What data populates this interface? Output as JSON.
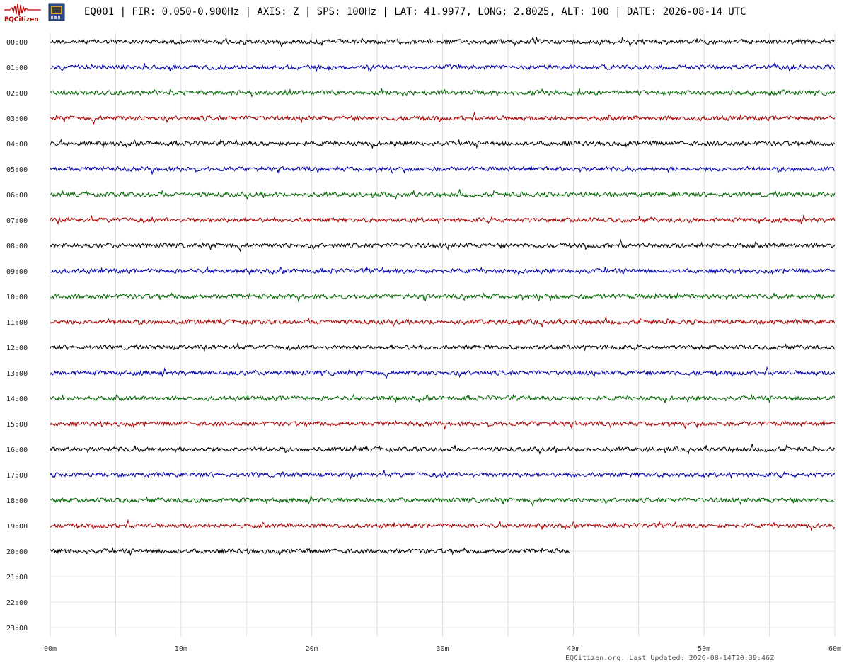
{
  "header": {
    "logo_text": "EQCitizen",
    "title": "EQ001 | FIR: 0.050-0.900Hz | AXIS: Z | SPS: 100Hz | LAT: 41.9977, LONG: 2.8025, ALT: 100 | DATE: 2026-08-14 UTC"
  },
  "footer": {
    "text": "EQCitizen.org. Last Updated: 2026-08-14T20:39:46Z"
  },
  "chart_data": {
    "type": "line",
    "title": "",
    "xlabel": "",
    "ylabel": "",
    "grid": true,
    "xlim": [
      0,
      60
    ],
    "x_tick_labels": [
      "00m",
      "10m",
      "20m",
      "30m",
      "40m",
      "50m",
      "60m"
    ],
    "x_ticks_minutes": [
      0,
      10,
      20,
      30,
      40,
      50,
      60
    ],
    "x_minor_step_minutes": 5,
    "row_labels": [
      "00:00",
      "01:00",
      "02:00",
      "03:00",
      "04:00",
      "05:00",
      "06:00",
      "07:00",
      "08:00",
      "09:00",
      "10:00",
      "11:00",
      "12:00",
      "13:00",
      "14:00",
      "15:00",
      "16:00",
      "17:00",
      "18:00",
      "19:00",
      "20:00",
      "21:00",
      "22:00",
      "23:00"
    ],
    "trace_colors": [
      "#000000",
      "#0000aa",
      "#006600",
      "#aa0000"
    ],
    "rows": [
      {
        "hour": "00:00",
        "end_minute": 60
      },
      {
        "hour": "01:00",
        "end_minute": 60
      },
      {
        "hour": "02:00",
        "end_minute": 60
      },
      {
        "hour": "03:00",
        "end_minute": 60
      },
      {
        "hour": "04:00",
        "end_minute": 60
      },
      {
        "hour": "05:00",
        "end_minute": 60
      },
      {
        "hour": "06:00",
        "end_minute": 60
      },
      {
        "hour": "07:00",
        "end_minute": 60
      },
      {
        "hour": "08:00",
        "end_minute": 60
      },
      {
        "hour": "09:00",
        "end_minute": 60
      },
      {
        "hour": "10:00",
        "end_minute": 60
      },
      {
        "hour": "11:00",
        "end_minute": 60
      },
      {
        "hour": "12:00",
        "end_minute": 60
      },
      {
        "hour": "13:00",
        "end_minute": 60
      },
      {
        "hour": "14:00",
        "end_minute": 60
      },
      {
        "hour": "15:00",
        "end_minute": 60
      },
      {
        "hour": "16:00",
        "end_minute": 60
      },
      {
        "hour": "17:00",
        "end_minute": 60
      },
      {
        "hour": "18:00",
        "end_minute": 60
      },
      {
        "hour": "19:00",
        "end_minute": 60
      },
      {
        "hour": "20:00",
        "end_minute": 39.8
      }
    ]
  }
}
